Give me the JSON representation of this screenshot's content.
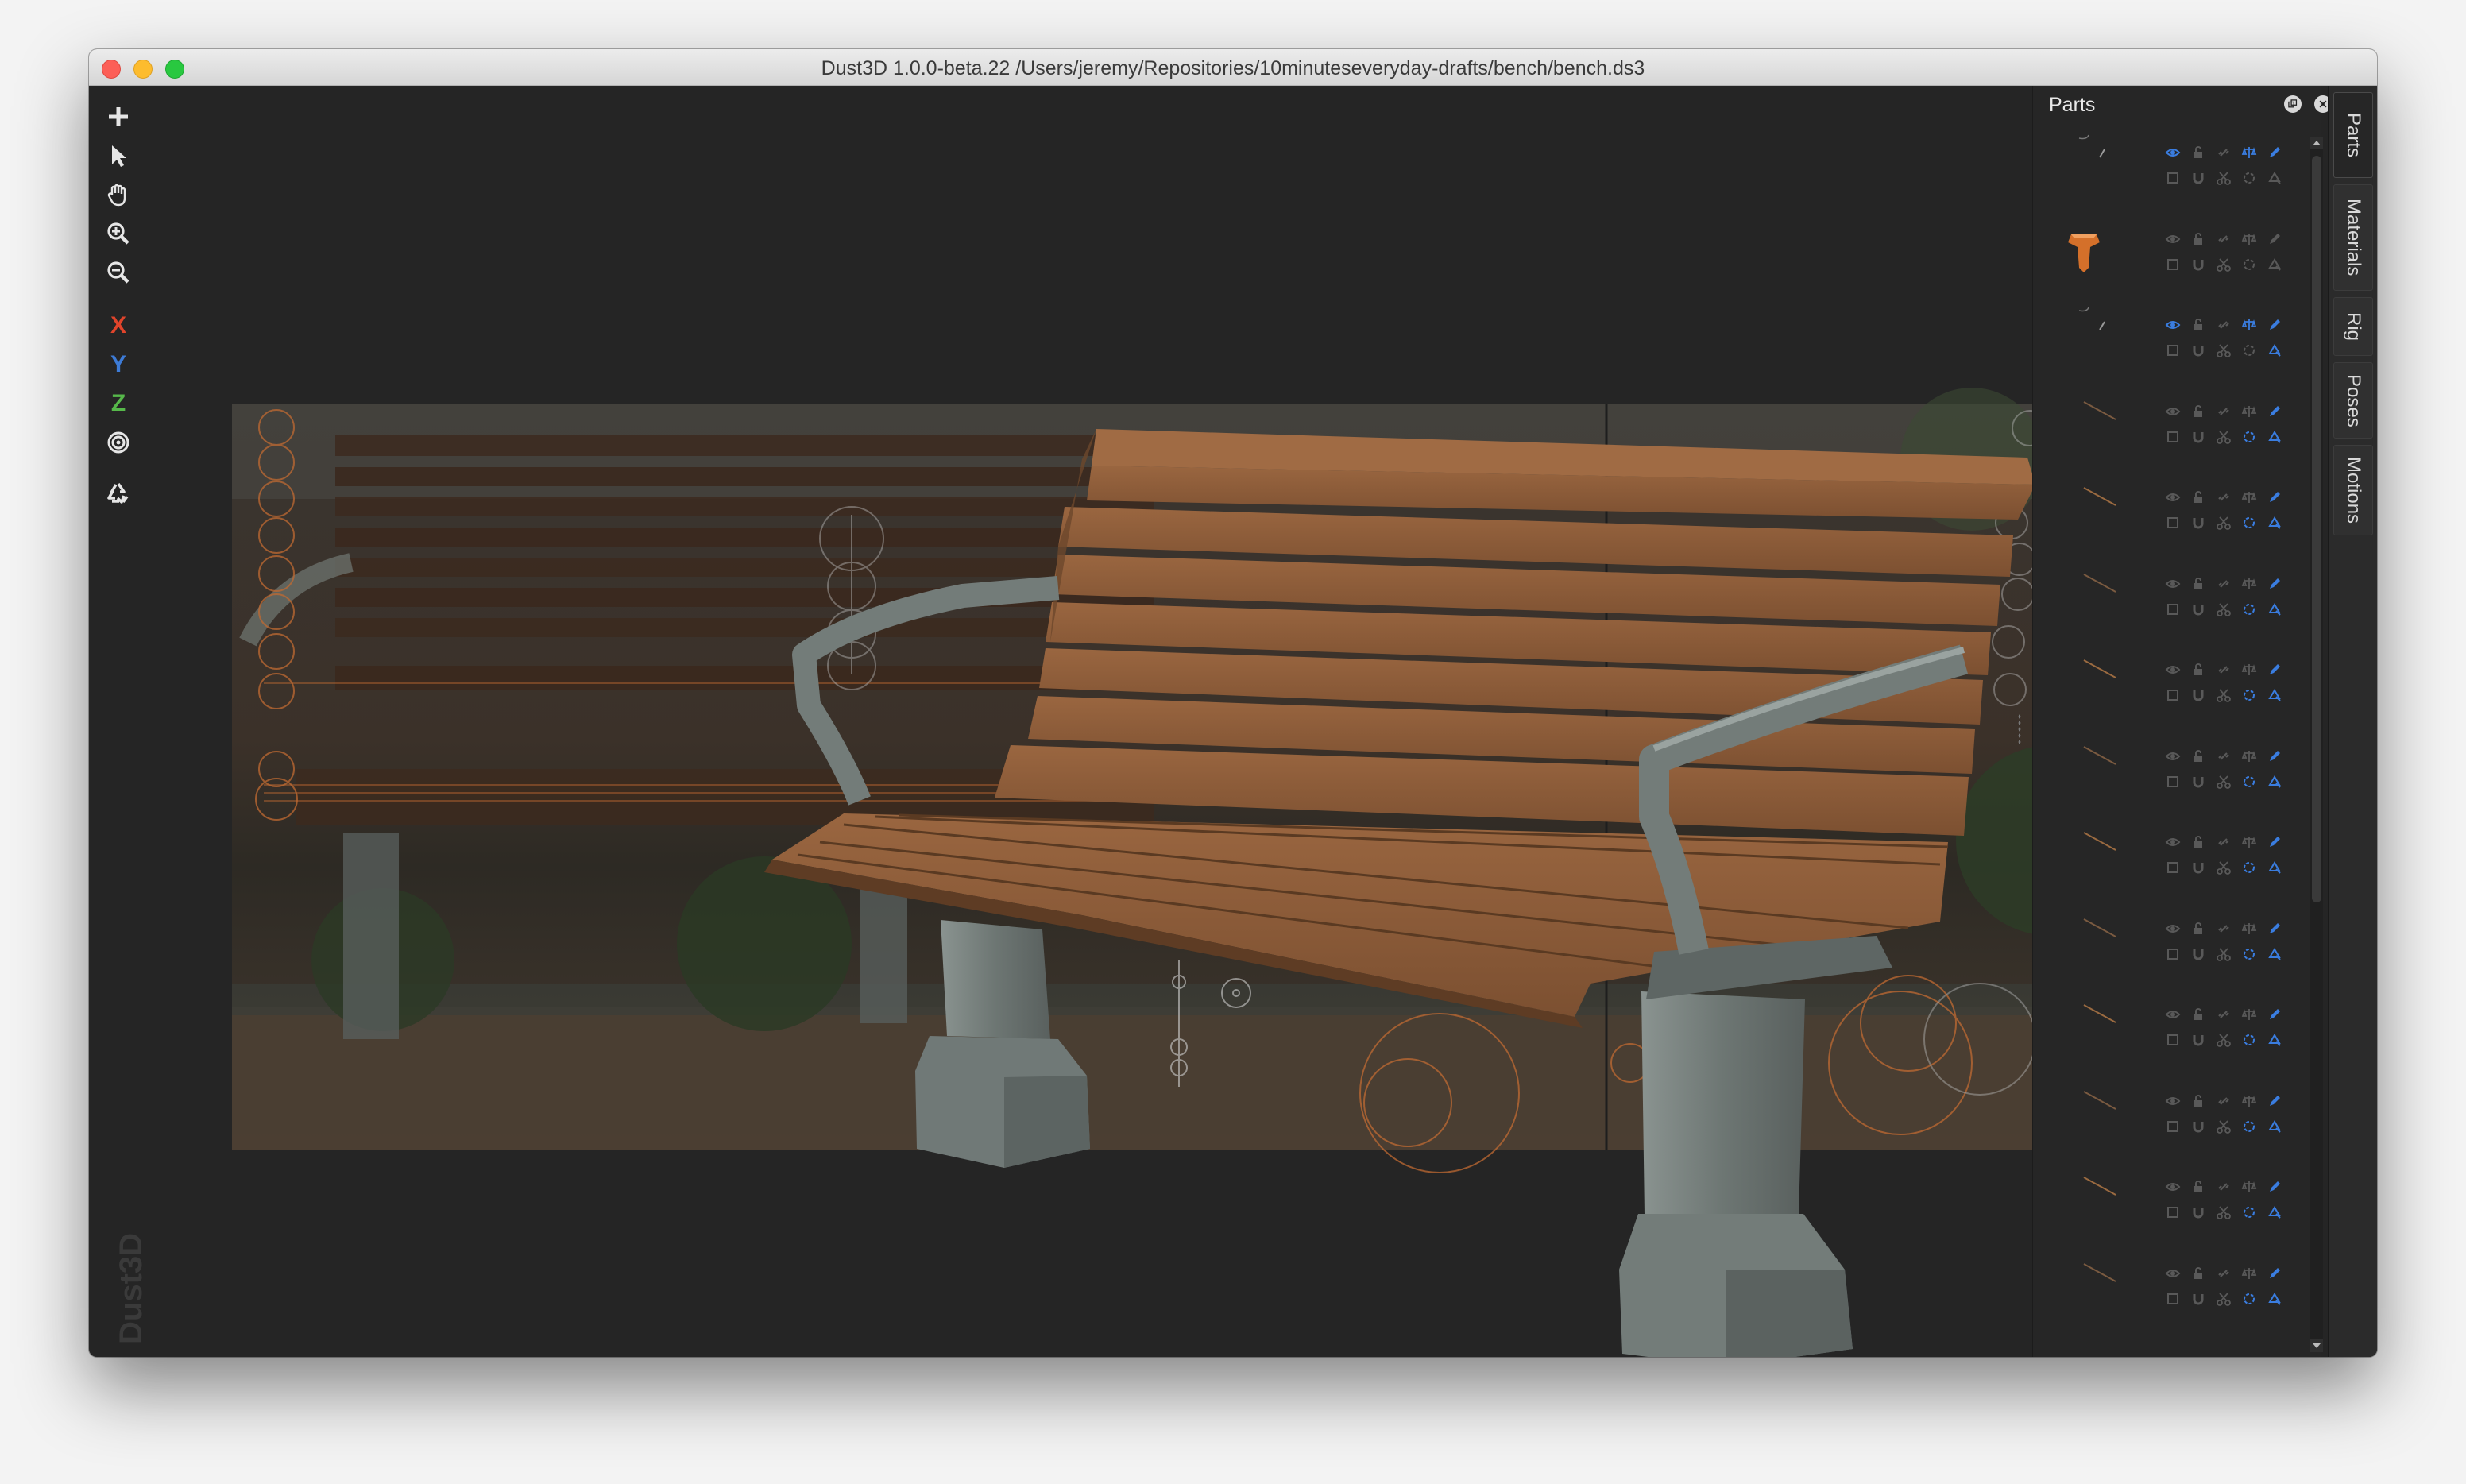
{
  "window": {
    "title": "Dust3D 1.0.0-beta.22 /Users/jeremy/Repositories/10minuteseveryday-drafts/bench/bench.ds3"
  },
  "toolbar": {
    "tools": [
      {
        "name": "add-icon"
      },
      {
        "name": "select-pointer-icon"
      },
      {
        "name": "pan-hand-icon"
      },
      {
        "name": "zoom-in-icon"
      },
      {
        "name": "zoom-out-icon"
      }
    ],
    "axes": [
      {
        "label": "X",
        "color": "#e0442b"
      },
      {
        "label": "Y",
        "color": "#3d7bd6"
      },
      {
        "label": "Z",
        "color": "#56b84a"
      }
    ],
    "radial_icon": "radial-target-icon",
    "regenerate_icon": "regenerate-recycle-icon"
  },
  "watermark": {
    "text": "Dust3D"
  },
  "parts_panel": {
    "title": "Parts",
    "float_icon": "float-window-icon",
    "close_icon": "close-icon",
    "row_count": 14,
    "icon_names": [
      "eye-icon",
      "lock-icon",
      "link-icon",
      "balance-icon",
      "pencil-icon",
      "checkbox-icon",
      "magnet-icon",
      "scissors-icon",
      "rotate-icon",
      "color-icon"
    ],
    "accent_color": "#3a7de0",
    "active_part_color": "#d4702a"
  },
  "side_tabs": {
    "tabs": [
      "Parts",
      "Materials",
      "Rig",
      "Poses",
      "Motions"
    ]
  },
  "colors": {
    "wood": "#8a5a36",
    "metal": "#6e7774",
    "background": "#252525"
  }
}
